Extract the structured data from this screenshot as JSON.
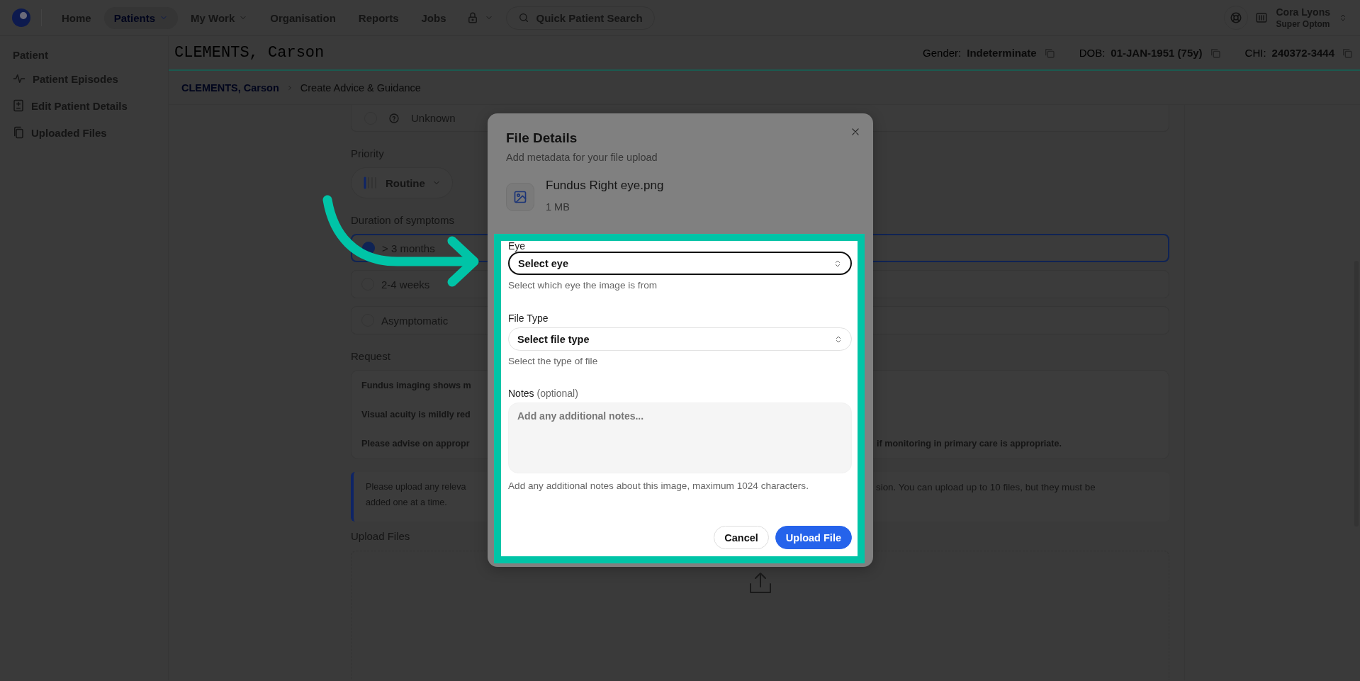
{
  "nav": {
    "items": [
      {
        "label": "Home",
        "selected": false,
        "dropdown": false
      },
      {
        "label": "Patients",
        "selected": true,
        "dropdown": true
      },
      {
        "label": "My Work",
        "selected": false,
        "dropdown": true
      },
      {
        "label": "Organisation",
        "selected": false,
        "dropdown": false
      },
      {
        "label": "Reports",
        "selected": false,
        "dropdown": false
      },
      {
        "label": "Jobs",
        "selected": false,
        "dropdown": false
      }
    ],
    "search": {
      "label": "Quick Patient Search"
    },
    "user": {
      "name": "Cora Lyons",
      "role": "Super Optom"
    }
  },
  "sidebar": {
    "heading": "Patient",
    "items": [
      {
        "label": "Patient Episodes"
      },
      {
        "label": "Edit Patient Details"
      },
      {
        "label": "Uploaded Files"
      }
    ]
  },
  "patient": {
    "name": "CLEMENTS, Carson",
    "details": [
      {
        "label": "Gender:",
        "value": "Indeterminate"
      },
      {
        "label": "DOB:",
        "value": "01-JAN-1951 (75y)"
      },
      {
        "label": "CHI:",
        "value": "240372-3444"
      }
    ]
  },
  "breadcrumb": [
    {
      "label": "CLEMENTS, Carson",
      "link": true
    },
    {
      "label": "Create Advice & Guidance",
      "link": false
    }
  ],
  "form": {
    "previous_option": {
      "label": "Unknown",
      "selected": false
    },
    "priority": {
      "label": "Priority",
      "value": "Routine"
    },
    "duration": {
      "label": "Duration of symptoms",
      "options": [
        {
          "label": "> 3 months",
          "selected": true
        },
        {
          "label": "2-4 weeks",
          "selected": false
        },
        {
          "label": "Asymptomatic",
          "selected": false
        }
      ]
    },
    "request": {
      "label": "Request",
      "lines": [
        {
          "left": "Fundus imaging shows m"
        },
        {
          "left": "Visual acuity is mildly red"
        },
        {
          "left": "Please advise on appropr",
          "right": "if monitoring in primary care is appropriate."
        }
      ]
    },
    "notice": {
      "lines": [
        {
          "left": "Please upload any releva",
          "right": "sion. You can upload up to 10 files, but they must be"
        },
        {
          "left": "added one at a time."
        }
      ]
    },
    "upload": {
      "label": "Upload Files"
    }
  },
  "modal": {
    "title": "File Details",
    "subtitle": "Add metadata for your file upload",
    "file": {
      "name": "Fundus Right eye.png",
      "size": "1 MB"
    },
    "fields": [
      {
        "kind": "select",
        "label": "Eye",
        "value": "Select eye",
        "help": "Select which eye the image is from",
        "focused": true
      },
      {
        "kind": "select",
        "label": "File Type",
        "value": "Select file type",
        "help": "Select the type of file",
        "focused": false
      },
      {
        "kind": "textarea",
        "label": "Notes",
        "label_note": "(optional)",
        "placeholder": "Add any additional notes...",
        "help": "Add any additional notes about this image, maximum 1024 characters."
      }
    ],
    "buttons": [
      {
        "label": "Cancel",
        "kind": "secondary"
      },
      {
        "label": "Upload File",
        "kind": "primary"
      }
    ]
  },
  "annotation": {
    "highlight": true,
    "arrow": true
  }
}
